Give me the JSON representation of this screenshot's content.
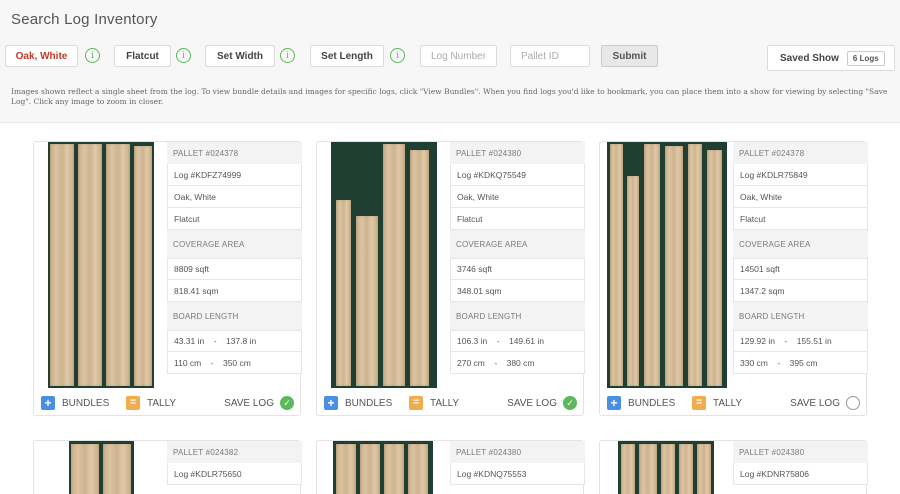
{
  "page_title": "Search Log Inventory",
  "filters": {
    "species": "Oak, White",
    "cut": "Flatcut",
    "width": "Set Width",
    "length": "Set Length",
    "info_glyph": "i",
    "log_number_placeholder": "Log Number",
    "pallet_id_placeholder": "Pallet ID",
    "submit": "Submit"
  },
  "saved_show": {
    "label": "Saved Show",
    "count": "6 Logs"
  },
  "notice": "Images shown reflect a single sheet from the log. To view bundle details and images for specific logs, click \"View Bundles\". When you find logs you'd like to bookmark, you can place them into a show for viewing by selecting \"Save Log\". Click any image to zoom in closer.",
  "labels": {
    "coverage_area": "COVERAGE AREA",
    "board_length": "BOARD LENGTH",
    "bundles": "BUNDLES",
    "tally": "TALLY",
    "save_log": "SAVE LOG",
    "bundles_icon": "+",
    "tally_icon": "=",
    "check_icon": "✓"
  },
  "logs": [
    {
      "pallet": "PALLET #024378",
      "log": "Log #KDFZ74999",
      "species": "Oak, White",
      "cut": "Flatcut",
      "sqft": "8809 sqft",
      "sqm": "818.41 sqm",
      "length_in": "43.31 in    -    137.8 in",
      "length_cm": "110 cm    -    350 cm",
      "saved": true
    },
    {
      "pallet": "PALLET #024380",
      "log": "Log #KDKQ75549",
      "species": "Oak, White",
      "cut": "Flatcut",
      "sqft": "3746 sqft",
      "sqm": "348.01 sqm",
      "length_in": "106.3 in    -    149.61 in",
      "length_cm": "270 cm    -    380 cm",
      "saved": true
    },
    {
      "pallet": "PALLET #024378",
      "log": "Log #KDLR75849",
      "species": "Oak, White",
      "cut": "Flatcut",
      "sqft": "14501 sqft",
      "sqm": "1347.2 sqm",
      "length_in": "129.92 in    -    155.51 in",
      "length_cm": "330 cm    -    395 cm",
      "saved": false
    },
    {
      "pallet": "PALLET #024382",
      "log": "Log #KDLR75650"
    },
    {
      "pallet": "PALLET #024380",
      "log": "Log #KDNQ75553"
    },
    {
      "pallet": "PALLET #024380",
      "log": "Log #KDNR75806"
    }
  ],
  "colors": {
    "accent_red": "#c0392b",
    "info_green": "#5cb85c",
    "bundles_blue": "#4a90e2",
    "tally_orange": "#f0ad4e",
    "photo_bg": "#1f3f32"
  }
}
